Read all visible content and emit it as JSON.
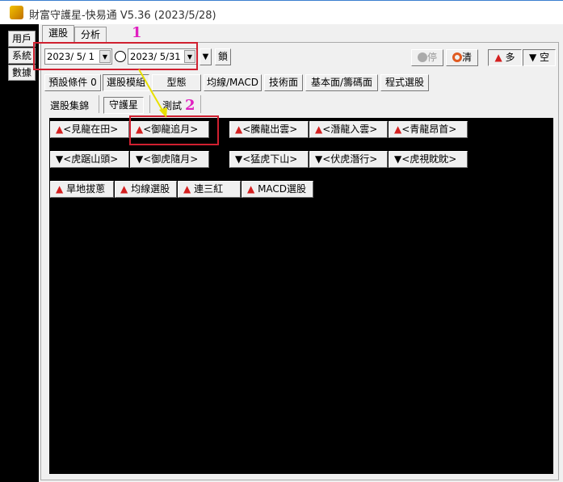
{
  "window": {
    "title": "財富守護星-快易通 V5.36 (2023/5/28)"
  },
  "left_menu": [
    "用戶",
    "系統",
    "數據"
  ],
  "tabs": [
    "選股",
    "分析"
  ],
  "toolbar": {
    "start_date": "2023/ 5/ 1",
    "end_date": "2023/ 5/31",
    "lock": "鎖",
    "stop": "停",
    "clear": "清",
    "long": "多",
    "short": "空"
  },
  "categories": [
    "預設條件 0",
    "選股模組",
    "型態",
    "均線/MACD",
    "技術面",
    "基本面/籌碼面",
    "程式選股"
  ],
  "subtabs": [
    "選股集錦",
    "守護星",
    "測試"
  ],
  "strategies": {
    "row1": [
      "<見龍在田>",
      "<御龍追月>",
      "<騰龍出雲>",
      "<潛龍入雲>",
      "<青龍昂首>"
    ],
    "row2": [
      "<虎踞山頭>",
      "<御虎隨月>",
      "<猛虎下山>",
      "<伏虎潛行>",
      "<虎視眈眈>"
    ],
    "row3": [
      "旱地拔蔥",
      "均線選股",
      "連三紅",
      "MACD選股"
    ]
  },
  "annotations": [
    "1",
    "2"
  ],
  "colors": {
    "up": "#d42020",
    "annotation_box": "#d02030",
    "annotation_number": "#e020c0",
    "arrow": "#e8e000"
  }
}
